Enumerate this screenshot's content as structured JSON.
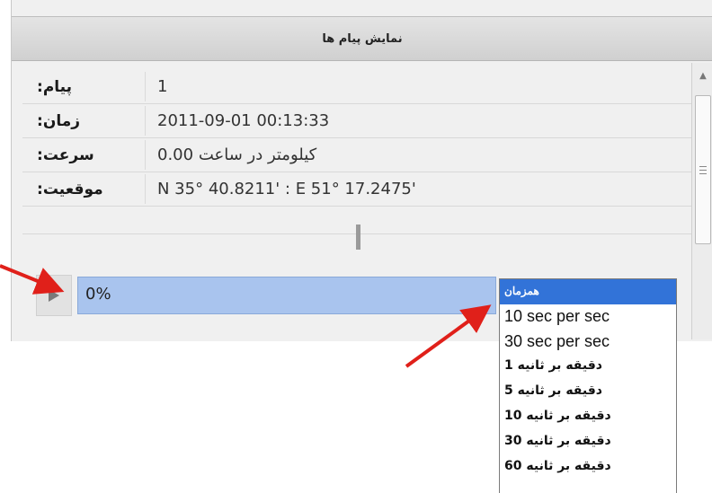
{
  "header": {
    "title": "نمایش پیام ها"
  },
  "info_rows": [
    {
      "label": ":پیام",
      "value": "1"
    },
    {
      "label": ":زمان",
      "value": "2011-09-01 00:13:33"
    },
    {
      "label": ":سرعت",
      "value": "0.00 کیلومتر در ساعت"
    },
    {
      "label": ":موقعیت",
      "value": "N 35° 40.8211' : E 51° 17.2475'"
    }
  ],
  "playback": {
    "progress_text": "0%",
    "progress_fraction": 0.0
  },
  "speed_options": [
    "همزمان",
    "10 sec per sec",
    "30 sec per sec",
    "دقیقه بر ثانیه 1",
    "دقیقه بر ثانیه 5",
    "دقیقه بر ثانیه 10",
    "دقیقه بر ثانیه 30",
    "دقیقه بر ثانیه 60"
  ],
  "colors": {
    "selected_option": "#3273d8",
    "progress_track": "#a9c4ee",
    "annotation_arrow": "#e0201a"
  },
  "icons": {
    "play": "play-icon",
    "scroll_up": "chevron-up-icon",
    "scroll_grip": "grip-lines-icon"
  }
}
